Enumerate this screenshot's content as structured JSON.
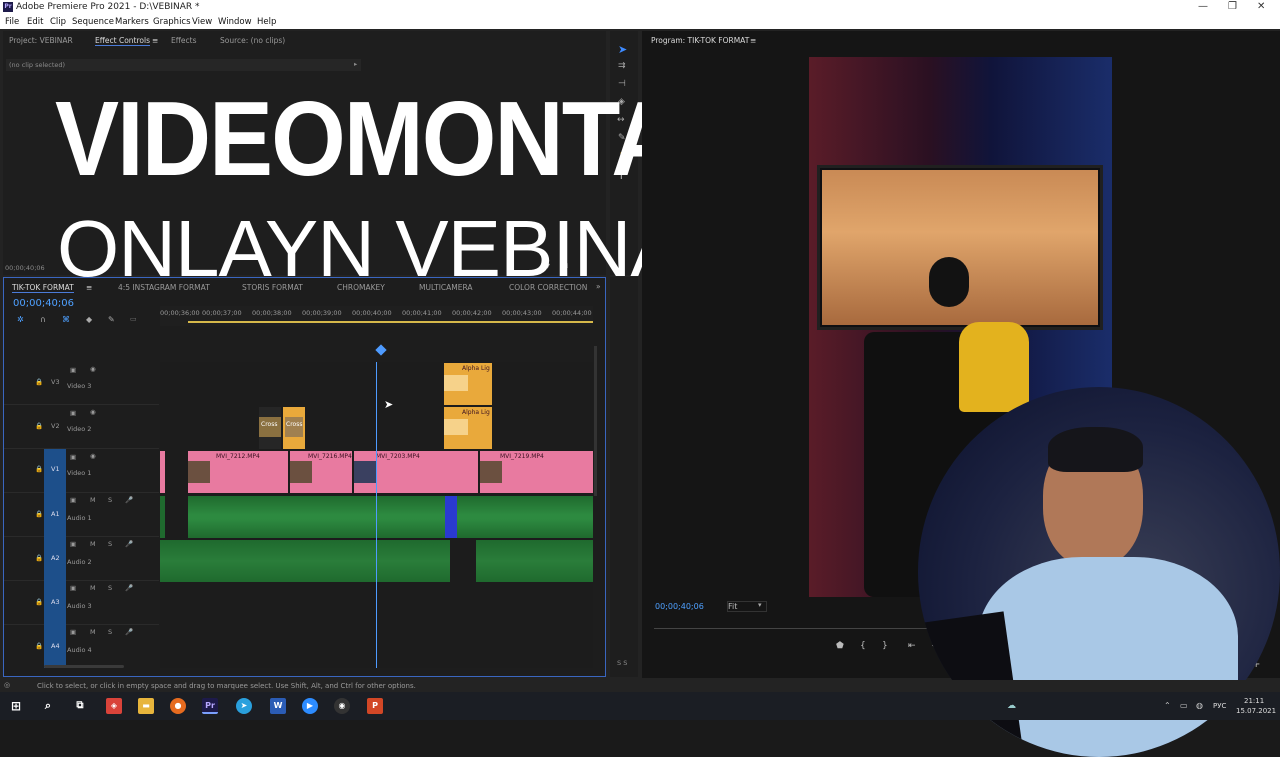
{
  "window": {
    "title": "Adobe Premiere Pro 2021 - D:\\VEBINAR *",
    "controls": [
      "—",
      "❐",
      "✕"
    ]
  },
  "menu": [
    "File",
    "Edit",
    "Clip",
    "Sequence",
    "Markers",
    "Graphics",
    "View",
    "Window",
    "Help"
  ],
  "source_panel": {
    "tabs": [
      "Project: VEBINAR",
      "Effect Controls",
      "Effects",
      "Source: (no clips)"
    ],
    "no_clip": "(no clip selected)",
    "timecode": "00;00;40;06"
  },
  "overlay": {
    "line1": "VIDEOMONTAJ",
    "line2": "ONLAYN VEBINAR"
  },
  "program": {
    "tab": "Program: TIK-TOK FORMAT",
    "timecode": "00;00;40;06",
    "fit": "Fit"
  },
  "timeline": {
    "tabs": [
      "TIK-TOK FORMAT",
      "4:5 INSTAGRAM FORMAT",
      "STORIS FORMAT",
      "CHROMAKEY",
      "MULTICAMERA",
      "COLOR CORRECTION"
    ],
    "timecode": "00;00;40;06",
    "ruler": [
      "00;00;36;00",
      "00;00;37;00",
      "00;00;38;00",
      "00;00;39;00",
      "00;00;40;00",
      "00;00;41;00",
      "00;00;42;00",
      "00;00;43;00",
      "00;00;44;00"
    ],
    "tracks": [
      {
        "id": "V3",
        "name": "Video 3"
      },
      {
        "id": "V2",
        "name": "Video 2"
      },
      {
        "id": "V1",
        "name": "Video 1"
      },
      {
        "id": "A1",
        "name": "Audio 1"
      },
      {
        "id": "A2",
        "name": "Audio 2"
      },
      {
        "id": "A3",
        "name": "Audio 3"
      },
      {
        "id": "A4",
        "name": "Audio 4"
      }
    ],
    "clips_v1": [
      "MVI_7212.MP4",
      "MVI_7216.MP4",
      "MVI_7203.MP4",
      "MVI_7219.MP4"
    ],
    "clips_v2": [
      "Cross",
      "Cross",
      "Alpha Lig"
    ],
    "clip_v3": "Alpha Lig",
    "ms_labels": [
      "M",
      "S"
    ]
  },
  "status": "Click to select, or click in empty space and drag to marquee select. Use Shift, Alt, and Ctrl for other options.",
  "taskbar": {
    "lang": "РУС",
    "time": "21:11",
    "date": "15.07.2021"
  }
}
